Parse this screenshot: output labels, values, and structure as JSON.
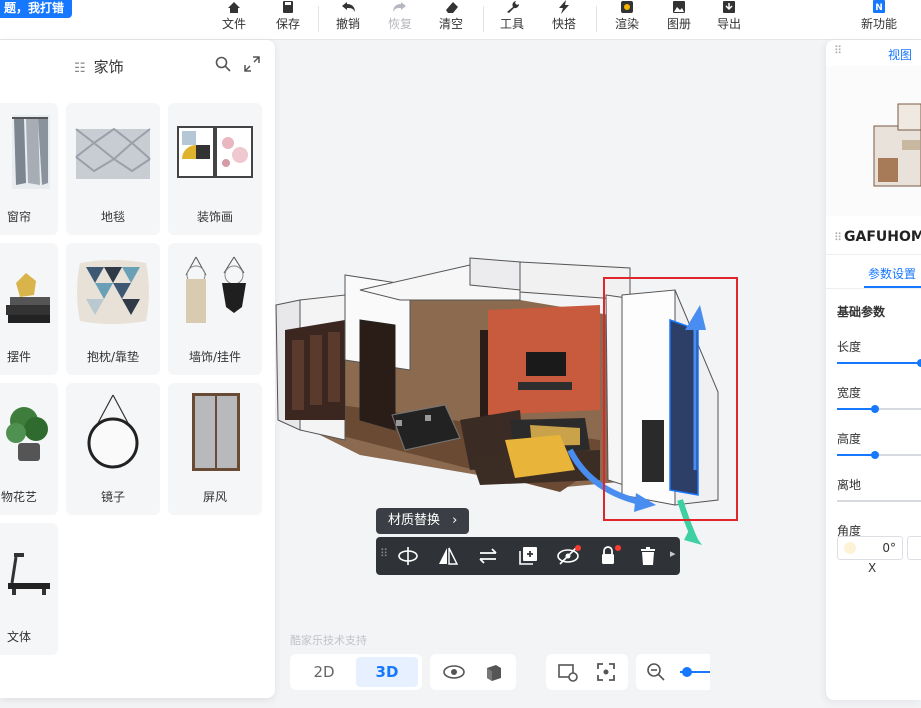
{
  "topbar": {
    "promo": "题，我打错",
    "items": [
      {
        "label": "文件",
        "icon": "home-icon",
        "enabled": true
      },
      {
        "label": "保存",
        "icon": "save-icon",
        "enabled": true
      },
      {
        "label": "撤销",
        "icon": "undo-icon",
        "enabled": true
      },
      {
        "label": "恢复",
        "icon": "redo-icon",
        "enabled": false
      },
      {
        "label": "清空",
        "icon": "eraser-icon",
        "enabled": true
      },
      {
        "label": "工具",
        "icon": "wrench-icon",
        "enabled": true
      },
      {
        "label": "快搭",
        "icon": "lightning-icon",
        "enabled": true
      },
      {
        "label": "渲染",
        "icon": "render-icon",
        "enabled": true
      },
      {
        "label": "图册",
        "icon": "album-icon",
        "enabled": true
      },
      {
        "label": "导出",
        "icon": "export-icon",
        "enabled": true
      },
      {
        "label": "新功能",
        "icon": "new-feature-icon",
        "enabled": true
      }
    ]
  },
  "catalog": {
    "title": "家饰",
    "items": [
      {
        "label": "窗帘",
        "icon": "curtain-icon"
      },
      {
        "label": "地毯",
        "icon": "carpet-icon"
      },
      {
        "label": "装饰画",
        "icon": "painting-icon"
      },
      {
        "label": "摆件",
        "icon": "ornament-icon"
      },
      {
        "label": "抱枕/靠垫",
        "icon": "pillow-icon"
      },
      {
        "label": "墙饰/挂件",
        "icon": "wall-hanging-icon"
      },
      {
        "label": "物花艺",
        "icon": "plant-icon"
      },
      {
        "label": "镜子",
        "icon": "mirror-icon"
      },
      {
        "label": "屏风",
        "icon": "screen-icon"
      },
      {
        "label": "文体",
        "icon": "treadmill-icon"
      }
    ]
  },
  "right_panel": {
    "view_tab": "视图",
    "product_name": "GAFUHOM",
    "tab": "参数设置",
    "section": "基础参数",
    "params": [
      {
        "label": "长度",
        "level": 1.0
      },
      {
        "label": "宽度",
        "level": 0.45
      },
      {
        "label": "高度",
        "level": 0.45
      },
      {
        "label": "离地",
        "level": 0.0
      },
      {
        "label": "角度",
        "level": 0.0
      }
    ],
    "angle_value": "0°",
    "axis_label": "X"
  },
  "object_toolbar": {
    "material_replace": "材质替换",
    "chevron": "›",
    "tools": [
      {
        "name": "rotate-icon",
        "glyph": "⟲"
      },
      {
        "name": "mirror-icon",
        "glyph": "◭"
      },
      {
        "name": "swap-icon",
        "glyph": "⇄"
      },
      {
        "name": "duplicate-icon",
        "glyph": "⊞"
      },
      {
        "name": "hide-icon",
        "glyph": "◎"
      },
      {
        "name": "lock-icon",
        "glyph": "🔒"
      },
      {
        "name": "delete-icon",
        "glyph": "🗑"
      }
    ]
  },
  "view_controls": {
    "mode_2d": "2D",
    "mode_3d": "3D",
    "active_mode": "3D",
    "watermark": "酷家乐技术支持"
  },
  "colors": {
    "accent": "#1677ff",
    "selection": "#e0262a",
    "toolbar_dark": "#2f3338"
  }
}
